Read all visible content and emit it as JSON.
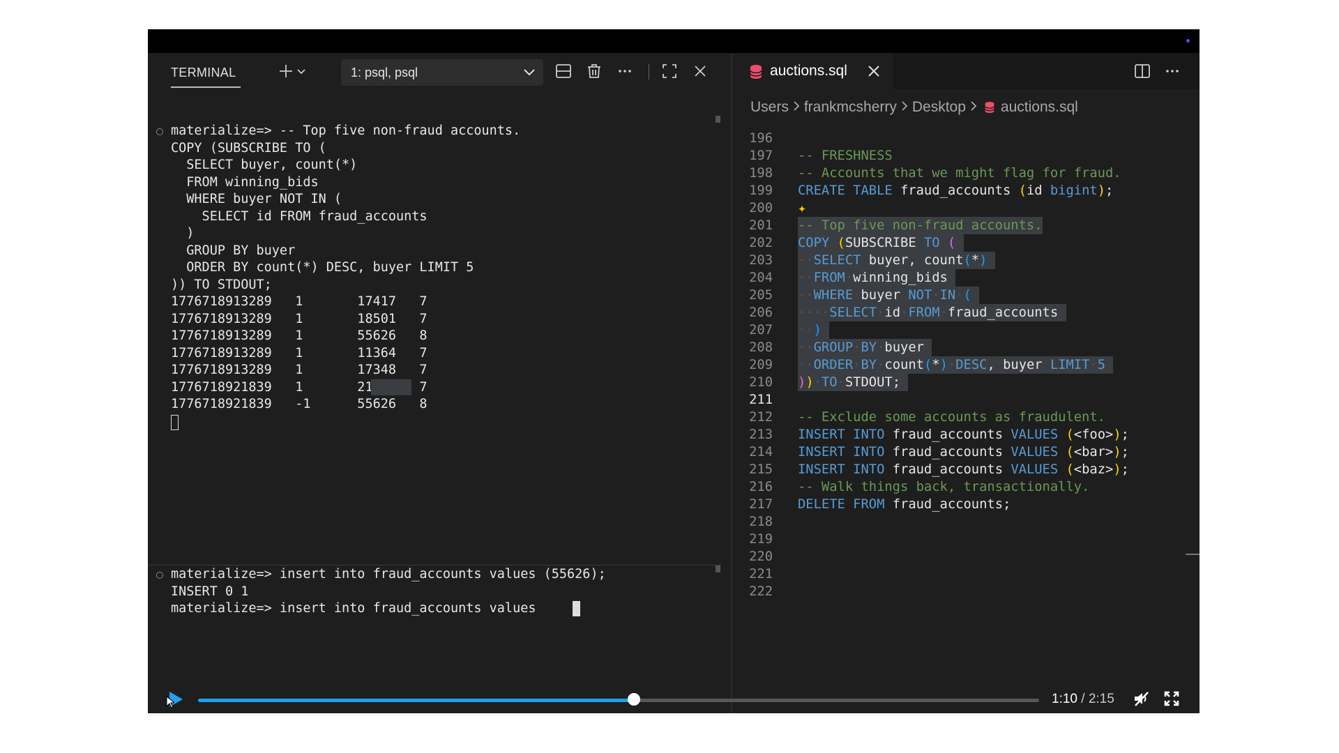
{
  "terminal": {
    "title": "TERMINAL",
    "session_select": "1: psql, psql",
    "pane1_lines": [
      "materialize=> -- Top five non-fraud accounts.",
      "COPY (SUBSCRIBE TO (",
      "  SELECT buyer, count(*)",
      "  FROM winning_bids",
      "  WHERE buyer NOT IN (",
      "    SELECT id FROM fraud_accounts",
      "  )",
      "  GROUP BY buyer",
      "  ORDER BY count(*) DESC, buyer LIMIT 5",
      ")) TO STDOUT;",
      "1776718913289   1       17417   7",
      "1776718913289   1       18501   7",
      "1776718913289   1       55626   8",
      "1776718913289   1       11364   7",
      "1776718913289   1       17348   7",
      "1776718921839   1       21259   7",
      "1776718921839   -1      55626   8"
    ],
    "pane2_lines": [
      "materialize=> insert into fraud_accounts values (55626);",
      "INSERT 0 1",
      "materialize=> insert into fraud_accounts values "
    ],
    "icons": [
      "plus-icon",
      "chevron-down-icon",
      "chevron-down-icon",
      "split-pane-icon",
      "trash-icon",
      "ellipsis-icon",
      "maximize-icon",
      "close-icon"
    ]
  },
  "editor": {
    "tab_label": "auctions.sql",
    "breadcrumb": [
      "Users",
      "frankmcsherry",
      "Desktop",
      "auctions.sql"
    ],
    "icons": [
      "database-icon",
      "close-icon",
      "split-editor-icon",
      "ellipsis-icon",
      "sparkle-icon"
    ],
    "line_numbers": [
      "196",
      "197",
      "198",
      "199",
      "200",
      "201",
      "202",
      "203",
      "204",
      "205",
      "206",
      "207",
      "208",
      "209",
      "210",
      "211",
      "212",
      "213",
      "214",
      "215",
      "216",
      "217",
      "218",
      "219",
      "220",
      "221",
      "222"
    ],
    "active_line": "211",
    "code": {
      "l197": "-- FRESHNESS",
      "l198": "-- Accounts that we might flag for fraud.",
      "l199_kw": "CREATE TABLE",
      "l199_name": "fraud_accounts",
      "l199_col": "id",
      "l199_type": "bigint",
      "l201": "-- Top five non-fraud accounts.",
      "l202_a": "COPY",
      "l202_b": "SUBSCRIBE",
      "l202_c": "TO",
      "l203_a": "SELECT",
      "l203_b": "buyer, count",
      "l204_a": "FROM",
      "l204_b": "winning_bids",
      "l205_a": "WHERE",
      "l205_b": "buyer",
      "l205_c": "NOT",
      "l205_d": "IN",
      "l206_a": "SELECT",
      "l206_b": "id",
      "l206_c": "FROM",
      "l206_d": "fraud_accounts",
      "l208_a": "GROUP",
      "l208_b": "BY",
      "l208_c": "buyer",
      "l209_a": "ORDER",
      "l209_b": "BY",
      "l209_c": "count",
      "l209_d": "DESC",
      "l209_e": "buyer",
      "l209_f": "LIMIT",
      "l209_g": "5",
      "l210_a": "TO",
      "l210_b": "STDOUT;",
      "l212": "-- Exclude some accounts as fraudulent.",
      "l213_a": "INSERT INTO",
      "l213_b": "fraud_accounts",
      "l213_c": "VALUES",
      "l213_d": "<foo>",
      "l214_d": "<bar>",
      "l215_d": "<baz>",
      "l216": "-- Walk things back, transactionally.",
      "l217_a": "DELETE FROM",
      "l217_b": "fraud_accounts;"
    }
  },
  "player": {
    "current_time": "1:10",
    "total_time": "2:15",
    "progress": 0.5185,
    "accent": "#1ea1f2",
    "icons": [
      "play-icon",
      "volume-muted-icon",
      "fullscreen-icon"
    ]
  }
}
